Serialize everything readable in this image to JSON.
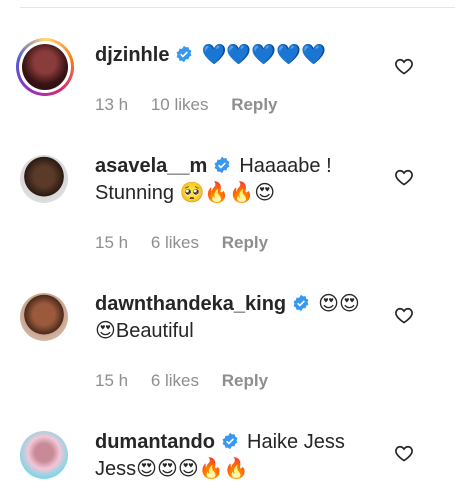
{
  "comments": [
    {
      "username": "djzinhle",
      "verified": true,
      "text": "💙💙💙💙💙",
      "time": "13 h",
      "likes": "10 likes",
      "reply": "Reply",
      "avatar_icon": "avatar-story-ring"
    },
    {
      "username": "asavela__m",
      "verified": true,
      "text": "Haaaabe ! Stunning 🥺🔥🔥😍",
      "time": "15 h",
      "likes": "6 likes",
      "reply": "Reply",
      "avatar_icon": "avatar"
    },
    {
      "username": "dawnthandeka_king",
      "verified": true,
      "text": "😍😍 😍Beautiful",
      "time": "15 h",
      "likes": "6 likes",
      "reply": "Reply",
      "avatar_icon": "avatar"
    },
    {
      "username": "dumantando",
      "verified": true,
      "text": "Haike Jess Jess😍😍😍🔥🔥",
      "avatar_icon": "avatar"
    }
  ],
  "colors": {
    "verified_blue": "#3897f0",
    "meta_gray": "#8e8e8e",
    "text": "#262626"
  }
}
